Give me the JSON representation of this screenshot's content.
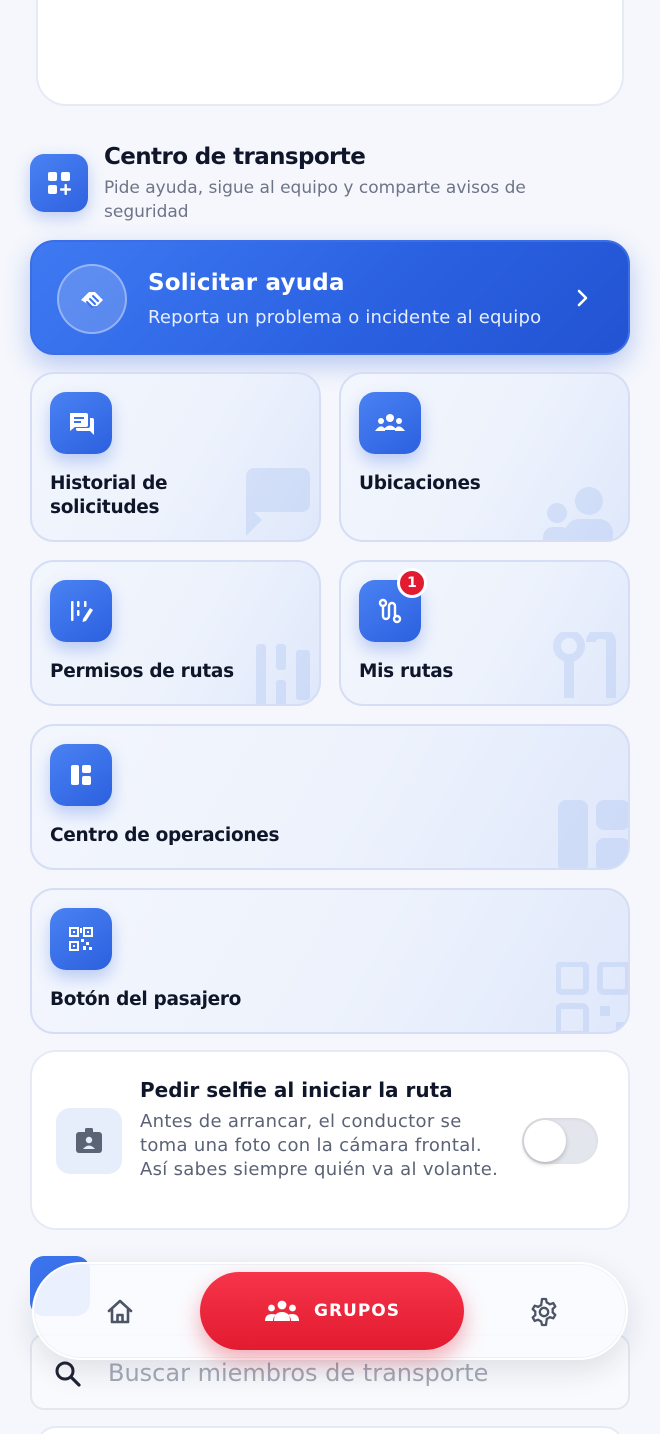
{
  "section": {
    "title": "Centro de transporte",
    "subtitle": "Pide ayuda, sigue al equipo y comparte avisos de seguridad"
  },
  "help_banner": {
    "title": "Solicitar ayuda",
    "subtitle": "Reporta un problema o incidente al equipo"
  },
  "tiles": {
    "history": {
      "label": "Historial de solicitudes",
      "icon": "chat-bubbles-icon"
    },
    "locations": {
      "label": "Ubicaciones",
      "icon": "people-group-icon"
    },
    "route_permissions": {
      "label": "Permisos de rutas",
      "icon": "route-edit-icon"
    },
    "my_routes": {
      "label": "Mis rutas",
      "icon": "route-icon",
      "badge": "1"
    },
    "operations": {
      "label": "Centro de operaciones",
      "icon": "dashboard-icon"
    },
    "passenger": {
      "label": "Botón del pasajero",
      "icon": "qr-code-icon"
    }
  },
  "selfie": {
    "title": "Pedir selfie al iniciar la ruta",
    "description": "Antes de arrancar, el conductor se toma una foto con la cámara frontal. Así sabes siempre quién va al volante.",
    "enabled": false
  },
  "search": {
    "placeholder": "Buscar miembros de transporte"
  },
  "bottom_nav": {
    "home_icon": "home-icon",
    "groups_label": "GRUPOS",
    "settings_icon": "gear-icon"
  },
  "colors": {
    "primary_blue": "#2f62e0",
    "accent_red": "#e21b30",
    "badge_red": "#e21b30"
  }
}
